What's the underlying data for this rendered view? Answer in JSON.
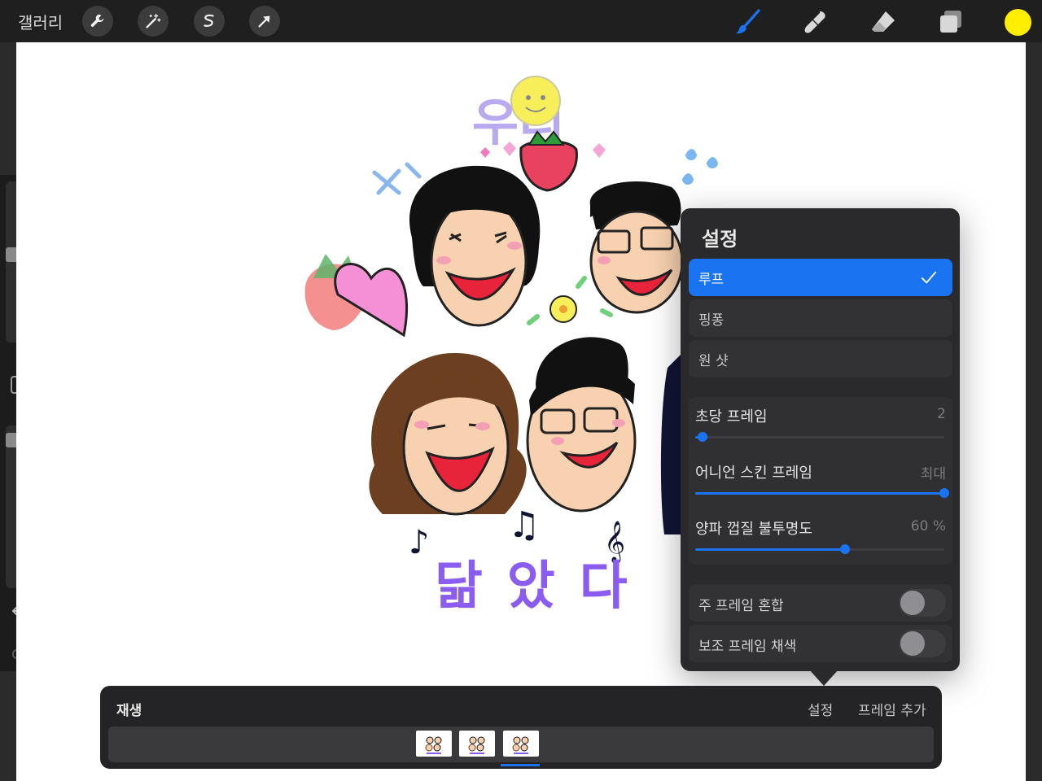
{
  "topbar": {
    "gallery_label": "갤러리",
    "left_tools": [
      "wrench-icon",
      "magic-wand-icon",
      "selection-icon",
      "transform-arrow-icon"
    ],
    "right_tools": [
      "brush-icon",
      "smudge-icon",
      "eraser-icon",
      "layers-icon"
    ],
    "current_color": "#ffee00",
    "accent_color": "#1a73f0"
  },
  "sidebar": {
    "brush_size_level": 0.55,
    "opacity_level": 0.95
  },
  "popover": {
    "title": "설정",
    "playback_options": [
      {
        "label": "루프",
        "selected": true
      },
      {
        "label": "핑퐁",
        "selected": false
      },
      {
        "label": "원 샷",
        "selected": false
      }
    ],
    "sliders": [
      {
        "label": "초당 프레임",
        "value": "2",
        "fraction": 0.03
      },
      {
        "label": "어니언 스킨 프레임",
        "value": "최대",
        "fraction": 1.0
      },
      {
        "label": "양파 껍질 불투명도",
        "value": "60 %",
        "fraction": 0.6
      }
    ],
    "toggles": [
      {
        "label": "주 프레임 혼합",
        "on": false
      },
      {
        "label": "보조 프레임 채색",
        "on": false
      }
    ]
  },
  "timeline": {
    "play_label": "재생",
    "settings_label": "설정",
    "add_frame_label": "프레임 추가",
    "frames_count": 3,
    "selected_frame": 3
  },
  "drawing": {
    "title_text": "우리",
    "bottom_text": "닮았다"
  }
}
